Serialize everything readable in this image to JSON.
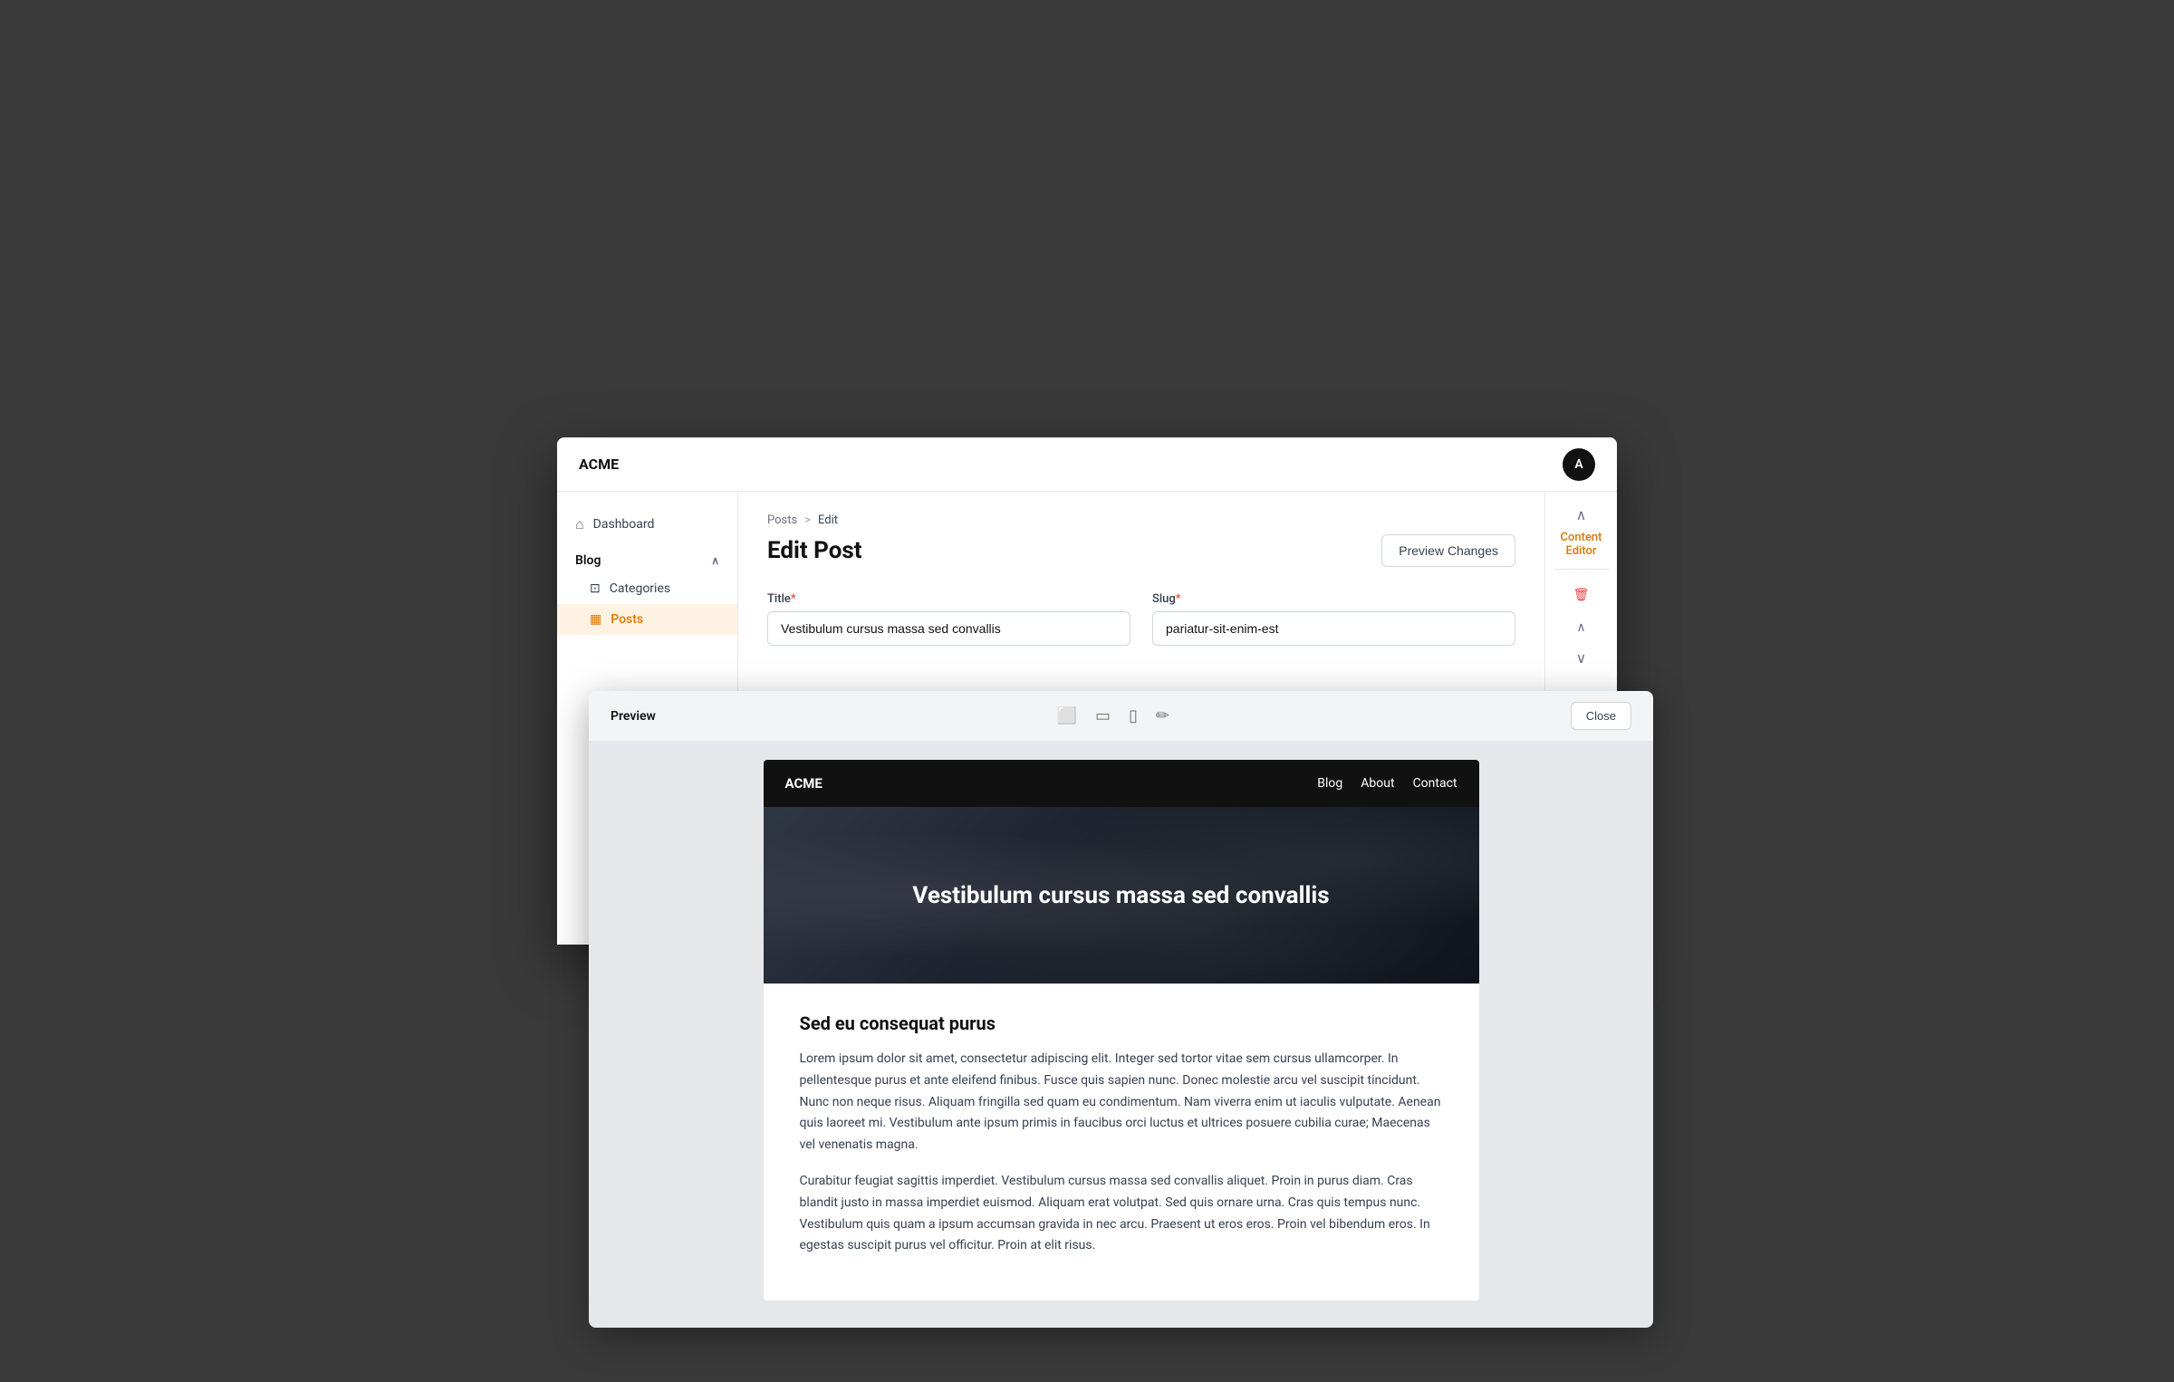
{
  "app": {
    "logo": "ACME",
    "avatar_initial": "A"
  },
  "sidebar": {
    "dashboard_label": "Dashboard",
    "blog_section": "Blog",
    "categories_label": "Categories",
    "posts_label": "Posts"
  },
  "breadcrumb": {
    "posts": "Posts",
    "separator": ">",
    "current": "Edit"
  },
  "page": {
    "title": "Edit Post",
    "preview_changes_btn": "Preview Changes"
  },
  "form": {
    "title_label": "Title",
    "title_required": "*",
    "title_value": "Vestibulum cursus massa sed convallis",
    "slug_label": "Slug",
    "slug_required": "*",
    "slug_value": "pariatur-sit-enim-est"
  },
  "right_panel": {
    "content_editor_label": "Content Editor",
    "delete_icon": "🗑",
    "up_icon": "∧",
    "down_icon": "∨"
  },
  "preview": {
    "title": "Preview",
    "close_btn": "Close",
    "devices": [
      "desktop",
      "tablet",
      "mobile",
      "paint"
    ],
    "site": {
      "logo": "ACME",
      "nav_links": [
        "Blog",
        "About",
        "Contact"
      ],
      "hero_title": "Vestibulum cursus massa sed convallis",
      "article_heading": "Sed eu consequat purus",
      "paragraph1": "Lorem ipsum dolor sit amet, consectetur adipiscing elit. Integer sed tortor vitae sem cursus ullamcorper. In pellentesque purus et ante eleifend finibus. Fusce quis sapien nunc. Donec molestie arcu vel suscipit tincidunt. Nunc non neque risus. Aliquam fringilla sed quam eu condimentum. Nam viverra enim ut iaculis vulputate. Aenean quis laoreet mi. Vestibulum ante ipsum primis in faucibus orci luctus et ultrices posuere cubilia curae; Maecenas vel venenatis magna.",
      "paragraph2": "Curabitur feugiat sagittis imperdiet. Vestibulum cursus massa sed convallis aliquet. Proin in purus diam. Cras blandit justo in massa imperdiet euismod. Aliquam erat volutpat. Sed quis ornare urna. Cras quis tempus nunc. Vestibulum quis quam a ipsum accumsan gravida in nec arcu. Praesent ut eros eros. Proin vel bibendum eros. In egestas suscipit purus vel officitur. Proin at elit risus."
    }
  }
}
